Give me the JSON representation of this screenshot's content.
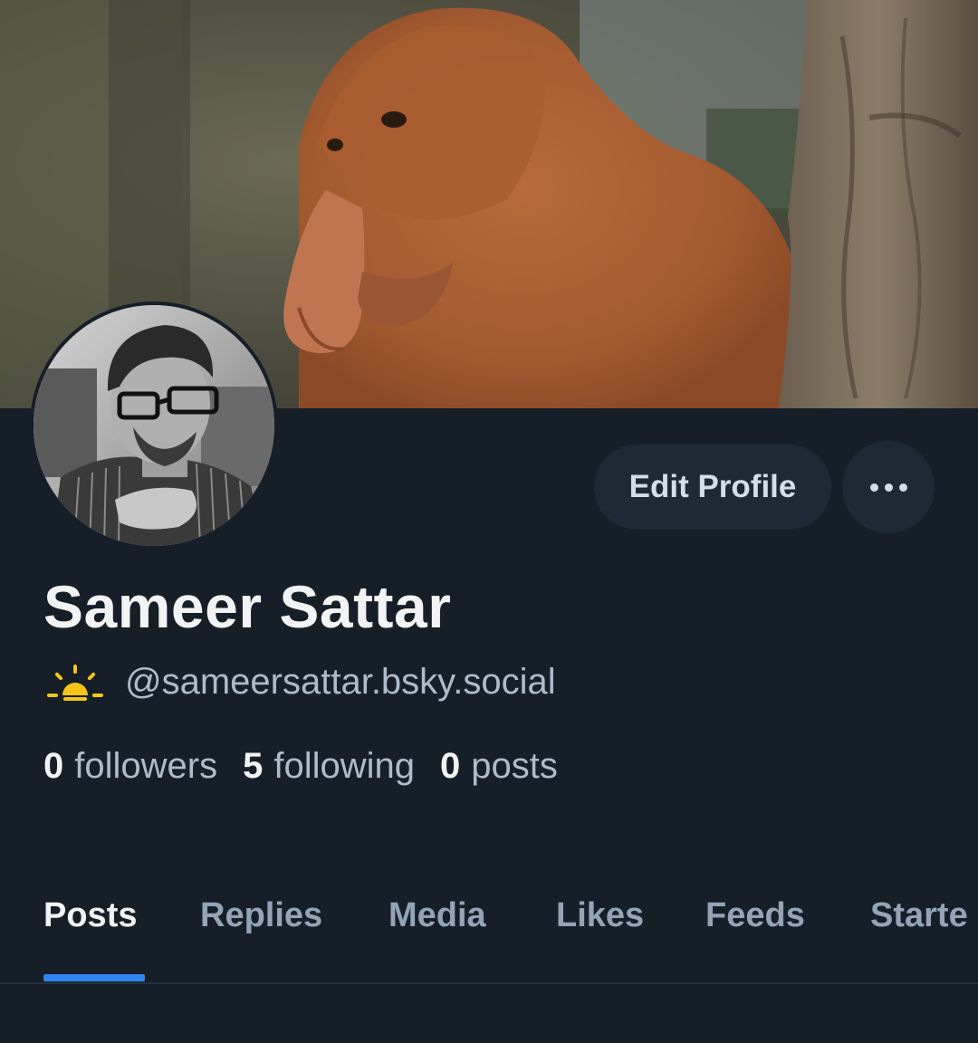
{
  "profile": {
    "display_name": "Sameer Sattar",
    "handle": "@sameersattar.bsky.social",
    "handle_icon": "sunrise-icon"
  },
  "actions": {
    "edit_profile_label": "Edit Profile",
    "more_icon": "ellipsis-icon"
  },
  "stats": {
    "followers_count": "0",
    "followers_label": "followers",
    "following_count": "5",
    "following_label": "following",
    "posts_count": "0",
    "posts_label": "posts"
  },
  "tabs": [
    {
      "label": "Posts",
      "active": true
    },
    {
      "label": "Replies",
      "active": false
    },
    {
      "label": "Media",
      "active": false
    },
    {
      "label": "Likes",
      "active": false
    },
    {
      "label": "Feeds",
      "active": false
    },
    {
      "label": "Starte",
      "active": false
    }
  ],
  "colors": {
    "background": "#161e27",
    "accent": "#2f85ef",
    "button_bg": "#1e2936"
  }
}
